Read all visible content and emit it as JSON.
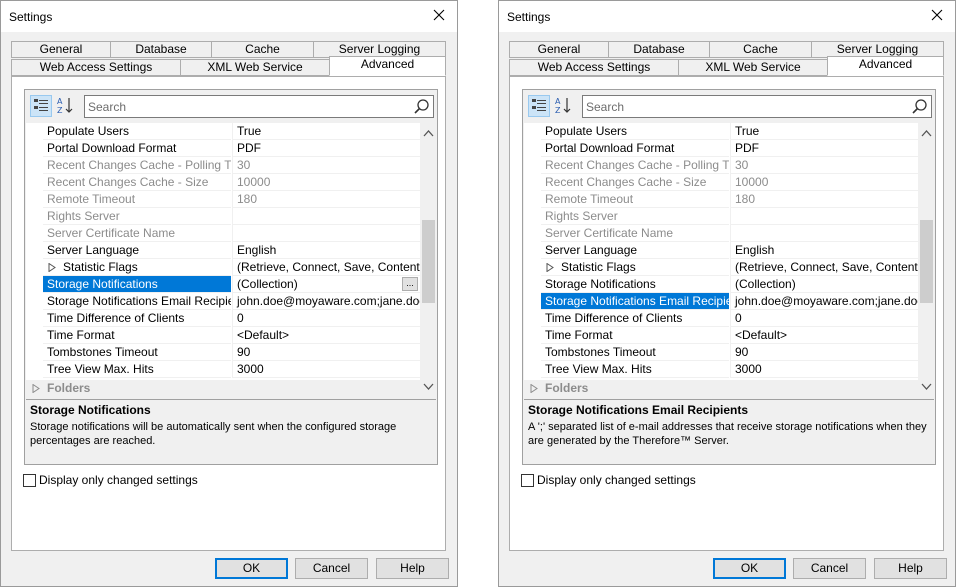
{
  "dialogs": [
    {
      "title": "Settings",
      "tabs_top": [
        "General",
        "Database",
        "Cache",
        "Server Logging"
      ],
      "tabs_bottom": [
        "Web Access Settings",
        "XML Web Service",
        "Advanced"
      ],
      "active_tab": "Advanced",
      "search": {
        "placeholder": "Search"
      },
      "rows": [
        {
          "name": "Populate Users",
          "value": "True",
          "state": "normal"
        },
        {
          "name": "Portal Download Format",
          "value": "PDF",
          "state": "normal"
        },
        {
          "name": "Recent Changes Cache - Polling Time",
          "value": "30",
          "state": "disabled"
        },
        {
          "name": "Recent Changes Cache - Size",
          "value": "10000",
          "state": "disabled"
        },
        {
          "name": "Remote Timeout",
          "value": "180",
          "state": "disabled"
        },
        {
          "name": "Rights Server",
          "value": "",
          "state": "disabled"
        },
        {
          "name": "Server Certificate Name",
          "value": "",
          "state": "disabled"
        },
        {
          "name": "Server Language",
          "value": "English",
          "state": "normal"
        },
        {
          "name": "Statistic Flags",
          "value": "(Retrieve, Connect, Save, Content ...",
          "state": "normal",
          "expandable": true
        },
        {
          "name": "Storage Notifications",
          "value": "(Collection)",
          "state": "selected",
          "has_button": true,
          "button_label": "..."
        },
        {
          "name": "Storage Notifications Email Recipients",
          "value": "john.doe@moyaware.com;jane.doe...",
          "state": "normal"
        },
        {
          "name": "Time Difference of Clients",
          "value": "0",
          "state": "normal"
        },
        {
          "name": "Time Format",
          "value": "<Default>",
          "state": "normal"
        },
        {
          "name": "Tombstones Timeout",
          "value": "90",
          "state": "normal"
        },
        {
          "name": "Tree View Max. Hits",
          "value": "3000",
          "state": "normal"
        }
      ],
      "category": "Folders",
      "description": {
        "title": "Storage Notifications",
        "text": "Storage notifications will be automatically sent when the configured storage percentages are reached."
      },
      "checkbox_label": "Display only changed settings",
      "checkbox_checked": false,
      "buttons": {
        "ok": "OK",
        "cancel": "Cancel",
        "help": "Help"
      }
    },
    {
      "title": "Settings",
      "tabs_top": [
        "General",
        "Database",
        "Cache",
        "Server Logging"
      ],
      "tabs_bottom": [
        "Web Access Settings",
        "XML Web Service",
        "Advanced"
      ],
      "active_tab": "Advanced",
      "search": {
        "placeholder": "Search"
      },
      "rows": [
        {
          "name": "Populate Users",
          "value": "True",
          "state": "normal"
        },
        {
          "name": "Portal Download Format",
          "value": "PDF",
          "state": "normal"
        },
        {
          "name": "Recent Changes Cache - Polling Time",
          "value": "30",
          "state": "disabled"
        },
        {
          "name": "Recent Changes Cache - Size",
          "value": "10000",
          "state": "disabled"
        },
        {
          "name": "Remote Timeout",
          "value": "180",
          "state": "disabled"
        },
        {
          "name": "Rights Server",
          "value": "",
          "state": "disabled"
        },
        {
          "name": "Server Certificate Name",
          "value": "",
          "state": "disabled"
        },
        {
          "name": "Server Language",
          "value": "English",
          "state": "normal"
        },
        {
          "name": "Statistic Flags",
          "value": "(Retrieve, Connect, Save, Content ...",
          "state": "normal",
          "expandable": true
        },
        {
          "name": "Storage Notifications",
          "value": "(Collection)",
          "state": "normal"
        },
        {
          "name": "Storage Notifications Email Recipients",
          "value": "john.doe@moyaware.com;jane.doe...",
          "state": "selected"
        },
        {
          "name": "Time Difference of Clients",
          "value": "0",
          "state": "normal"
        },
        {
          "name": "Time Format",
          "value": "<Default>",
          "state": "normal"
        },
        {
          "name": "Tombstones Timeout",
          "value": "90",
          "state": "normal"
        },
        {
          "name": "Tree View Max. Hits",
          "value": "3000",
          "state": "normal"
        }
      ],
      "category": "Folders",
      "description": {
        "title": "Storage Notifications Email Recipients",
        "text": "A ';' separated list of e-mail addresses that receive storage notifications when they are generated by the Therefore™ Server."
      },
      "checkbox_label": "Display only changed settings",
      "checkbox_checked": false,
      "buttons": {
        "ok": "OK",
        "cancel": "Cancel",
        "help": "Help"
      }
    }
  ]
}
